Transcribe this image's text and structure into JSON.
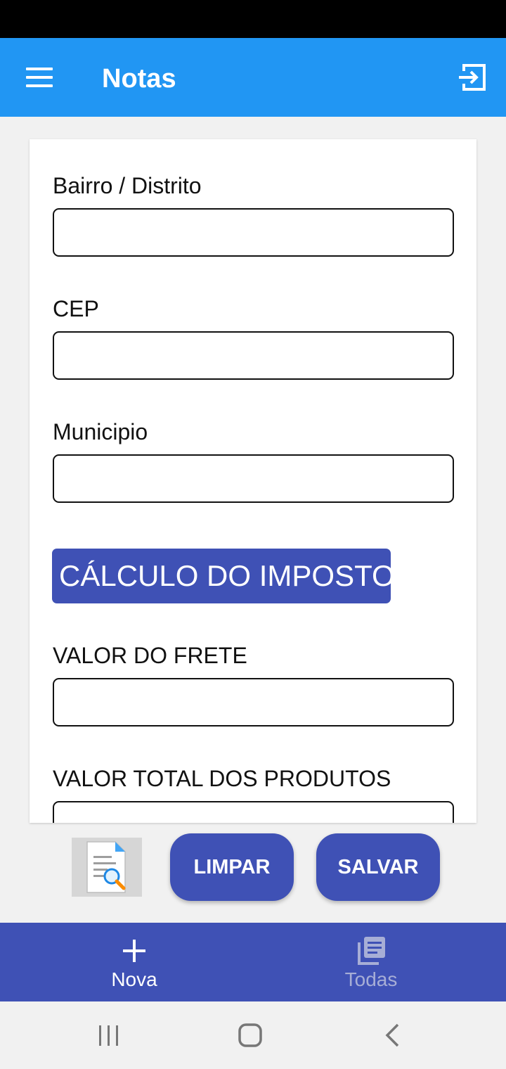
{
  "app": {
    "title": "Notas",
    "menu_icon": "hamburger-menu-icon",
    "logout_icon": "exit-icon",
    "colors": {
      "app_bar": "#2196f3",
      "primary": "#3f51b5",
      "status_bar": "#000000"
    }
  },
  "form": {
    "fields": [
      {
        "label": "Bairro / Distrito",
        "value": ""
      },
      {
        "label": "CEP",
        "value": ""
      },
      {
        "label": "Municipio",
        "value": ""
      },
      {
        "label": "VALOR DO FRETE",
        "value": ""
      },
      {
        "label": "VALOR TOTAL DOS PRODUTOS",
        "value": ""
      }
    ],
    "section_title": "CÁLCULO DO IMPOSTO"
  },
  "actions": {
    "doc_icon": "document-search-icon",
    "clear_label": "LIMPAR",
    "save_label": "SALVAR"
  },
  "bottom_nav": {
    "items": [
      {
        "label": "Nova",
        "icon": "plus-icon",
        "active": true
      },
      {
        "label": "Todas",
        "icon": "library-books-icon",
        "active": false
      }
    ]
  },
  "system_nav": {
    "recents_icon": "recents-icon",
    "home_icon": "home-icon",
    "back_icon": "back-icon"
  }
}
